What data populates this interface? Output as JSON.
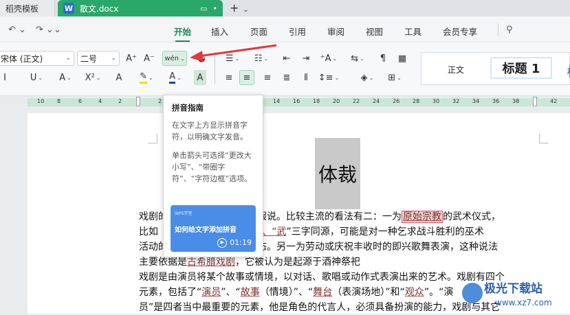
{
  "tabs": {
    "inactive_label": "稻壳模板",
    "active_label": "散文.docx",
    "active_icon_letter": "W",
    "new_tab": "+"
  },
  "menu": {
    "items": [
      "开始",
      "插入",
      "页面",
      "引用",
      "审阅",
      "视图",
      "工具",
      "会员专享"
    ],
    "active": "开始"
  },
  "ribbon": {
    "font_name": "宋体 (正文)",
    "font_size": "二号",
    "pinyin_icon": "wén",
    "style_normal": "正文",
    "style_heading": "标题 1",
    "style_edge": "标"
  },
  "ruler": {
    "ticks": [
      "10",
      "8",
      "6",
      "4",
      "2",
      "2",
      "14",
      "16",
      "18",
      "20",
      "22",
      "24",
      "26",
      "28",
      "30",
      "32",
      "34",
      "36",
      "38",
      "40",
      "42"
    ]
  },
  "tooltip": {
    "title": "拼音指南",
    "desc1": "在文字上方显示拼音字符，以明确文字发音。",
    "desc2": "单击箭头可选择“更改大小写”、“带圈字符”、“字符边框”选项。",
    "video_small": "WPS学堂",
    "video_title": "如何给文字添加拼音",
    "video_time": "01:19"
  },
  "document": {
    "title": "体裁",
    "lines": [
      [
        "戏剧的",
        "种假说。比较主流的看法有二：一为",
        "原始宗教",
        "的武术仪式，"
      ],
      [
        "比如",
        "舞”、“",
        "武",
        "”三字同源，可能是对一种乞求战斗胜利的巫术"
      ],
      [
        "活动的",
        "形态。另一为劳动或庆祝丰收时的即兴歌舞表演，这种说法"
      ],
      [
        "主要依据是",
        "古希腊戏剧",
        "，它被认为是起源于酒神祭祀"
      ],
      [
        "戏剧是由演员将某个故事或情境，以对话、歌唱或动作式表演出来的艺术。戏剧有四个"
      ],
      [
        "元素，包括了“",
        "演员",
        "”、“",
        "故事",
        "（情境）”、“",
        "舞台",
        "（表演场地）”和“",
        "观众",
        "”。“演"
      ],
      [
        "员”是四者当中最重要的元素，他是角色的代言人，必须具备扮演的能力，戏剧与其它"
      ]
    ]
  },
  "watermark": {
    "name": "极光下载站",
    "url": "www.xz7.com"
  },
  "colors": {
    "accent_green": "#2aa76a",
    "menu_active": "#1f8a52",
    "arrow_red": "#e03a3a"
  }
}
